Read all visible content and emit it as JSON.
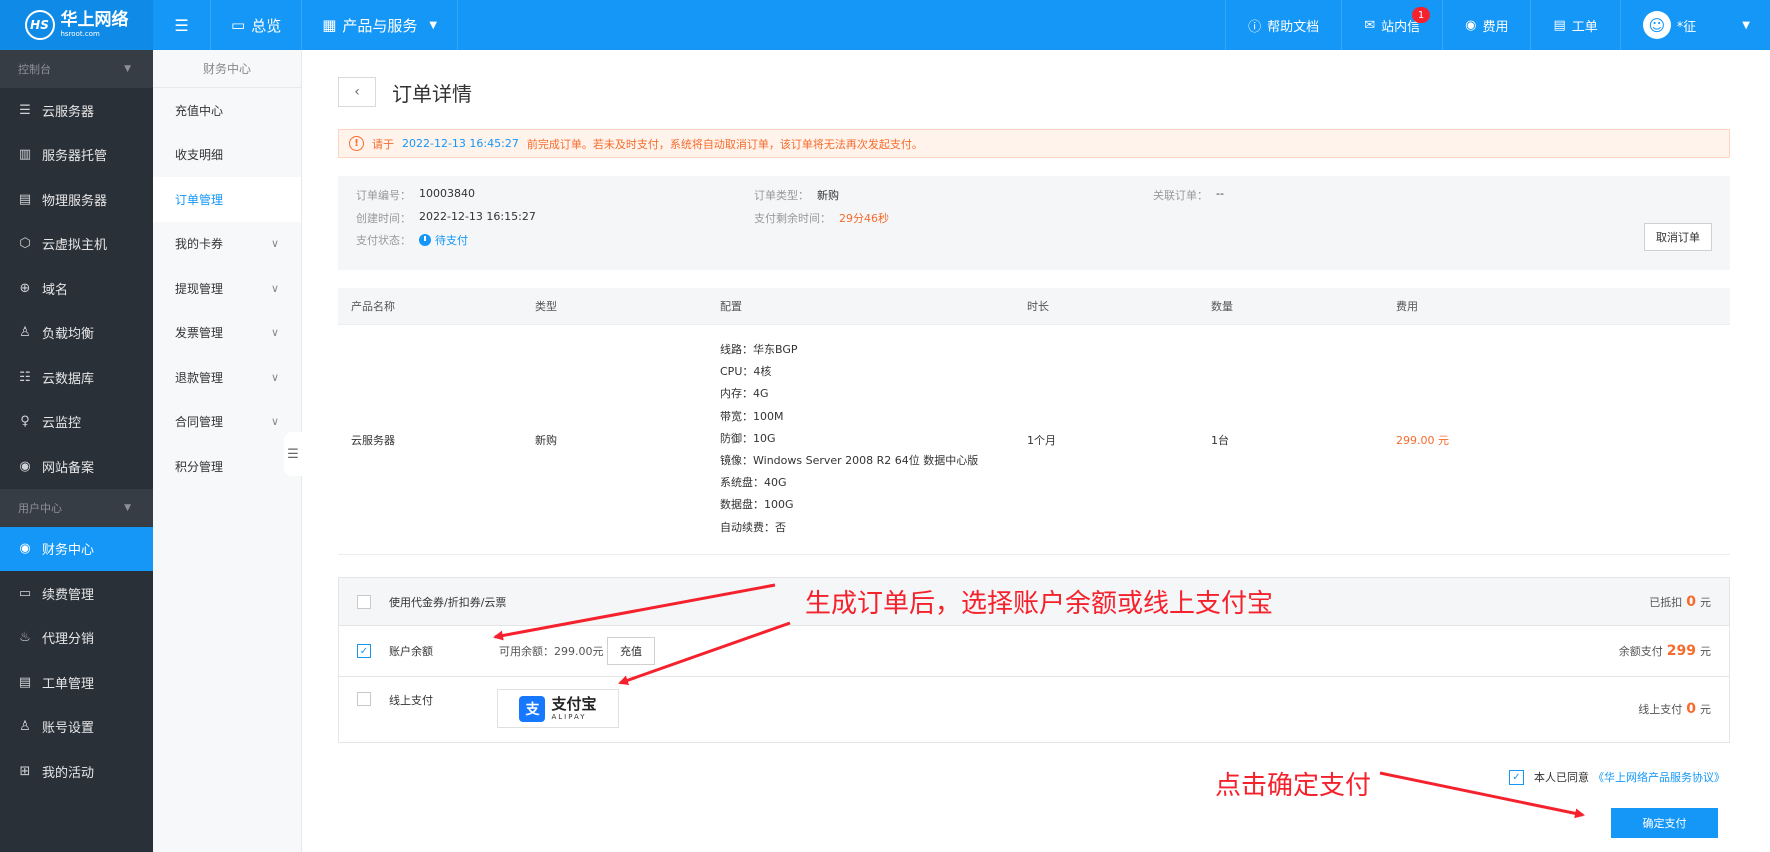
{
  "topbar": {
    "logo_name": "华上网络",
    "logo_sub": "hsroot.com",
    "overview": "总览",
    "products": "产品与服务",
    "help": "帮助文档",
    "messages": "站内信",
    "message_count": "1",
    "fees": "费用",
    "tickets": "工单",
    "user": "*征"
  },
  "sidebar": {
    "console_group": "控制台",
    "items": [
      {
        "label": "云服务器",
        "icon": "server-icon"
      },
      {
        "label": "服务器托管",
        "icon": "hosting-icon"
      },
      {
        "label": "物理服务器",
        "icon": "physical-server-icon"
      },
      {
        "label": "云虚拟主机",
        "icon": "cube-icon"
      },
      {
        "label": "域名",
        "icon": "globe-icon"
      },
      {
        "label": "负载均衡",
        "icon": "balance-icon"
      },
      {
        "label": "云数据库",
        "icon": "database-icon"
      },
      {
        "label": "云监控",
        "icon": "monitor-icon"
      },
      {
        "label": "网站备案",
        "icon": "record-icon"
      }
    ],
    "user_group": "用户中心",
    "user_items": [
      {
        "label": "财务中心",
        "icon": "finance-icon"
      },
      {
        "label": "续费管理",
        "icon": "renew-icon"
      },
      {
        "label": "代理分销",
        "icon": "agent-icon"
      },
      {
        "label": "工单管理",
        "icon": "ticket-icon"
      },
      {
        "label": "账号设置",
        "icon": "user-icon"
      },
      {
        "label": "我的活动",
        "icon": "gift-icon"
      }
    ]
  },
  "subnav": {
    "title": "财务中心",
    "items": [
      "充值中心",
      "收支明细",
      "订单管理",
      "我的卡券",
      "提现管理",
      "发票管理",
      "退款管理",
      "合同管理",
      "积分管理"
    ]
  },
  "page": {
    "title": "订单详情",
    "notice_pre": "请于",
    "notice_time": "2022-12-13 16:45:27",
    "notice_post": "前完成订单。若未及时支付，系统将自动取消订单，该订单将无法再次发起支付。"
  },
  "order": {
    "no_label": "订单编号：",
    "no": "10003840",
    "created_label": "创建时间：",
    "created": "2022-12-13 16:15:27",
    "status_label": "支付状态：",
    "status": "待支付",
    "type_label": "订单类型：",
    "type": "新购",
    "remaining_label": "支付剩余时间：",
    "remaining": "29分46秒",
    "related_label": "关联订单：",
    "related": "--",
    "cancel": "取消订单"
  },
  "table": {
    "headers": [
      "产品名称",
      "类型",
      "配置",
      "时长",
      "数量",
      "费用"
    ],
    "row": {
      "name": "云服务器",
      "type": "新购",
      "config": [
        "线路：华东BGP",
        "CPU：4核",
        "内存：4G",
        "带宽：100M",
        "防御：10G",
        "镜像：Windows Server 2008 R2 64位 数据中心版",
        "系统盘：40G",
        "数据盘：100G",
        "自动续费：否"
      ],
      "duration": "1个月",
      "quantity": "1台",
      "price": "299.00 元"
    }
  },
  "payment": {
    "coupon_label": "使用代金券/折扣券/云票",
    "coupon_right": "已抵扣",
    "coupon_value": "0",
    "balance_label": "账户余额",
    "balance_avail": "可用余额：299.00元",
    "recharge": "充值",
    "balance_right": "余额支付",
    "balance_value": "299",
    "online_label": "线上支付",
    "alipay_cn": "支付宝",
    "alipay_en": "ALIPAY",
    "online_right": "线上支付",
    "online_value": "0",
    "unit": "元"
  },
  "agree": {
    "text": "本人已同意",
    "link": "《华上网络产品服务协议》"
  },
  "confirm": "确定支付",
  "annotations": {
    "a1": "生成订单后，选择账户余额或线上支付宝",
    "a2": "点击确定支付"
  },
  "colors": {
    "primary": "#1497f7",
    "sidebar": "#2a3038",
    "accent": "#f56c2c",
    "annotation": "#f5222d"
  }
}
